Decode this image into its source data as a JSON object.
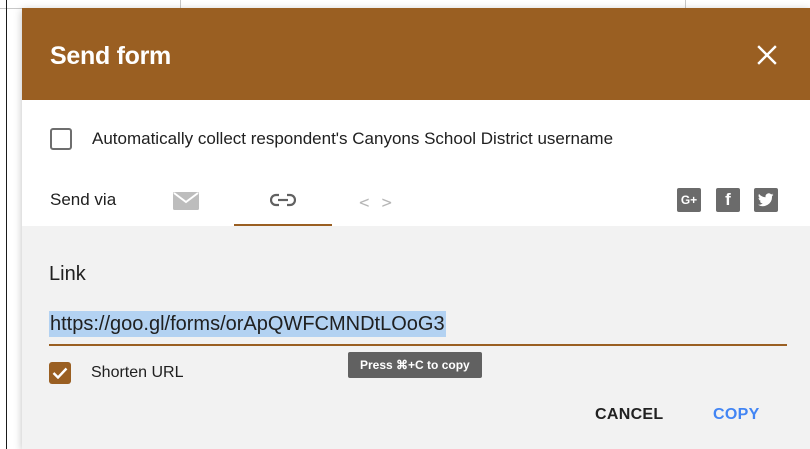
{
  "dialog": {
    "title": "Send form",
    "close_icon": "close-icon"
  },
  "collect": {
    "label": "Automatically collect respondent's Canyons School District username",
    "checked": false
  },
  "send_via": {
    "label": "Send via",
    "tabs": [
      {
        "id": "email",
        "icon": "email-icon",
        "active": false
      },
      {
        "id": "link",
        "icon": "link-icon",
        "active": true
      },
      {
        "id": "embed",
        "icon": "embed-code-icon",
        "glyph": "< >",
        "active": false
      }
    ],
    "social": [
      {
        "id": "google-plus",
        "icon": "google-plus-icon",
        "glyph": "G+"
      },
      {
        "id": "facebook",
        "icon": "facebook-icon",
        "glyph": "f"
      },
      {
        "id": "twitter",
        "icon": "twitter-icon"
      }
    ]
  },
  "link_panel": {
    "heading": "Link",
    "url": "https://goo.gl/forms/orApQWFCMNDtLOoG3",
    "shorten_label": "Shorten URL",
    "shorten_checked": true,
    "tooltip": "Press ⌘+C to copy"
  },
  "actions": {
    "cancel_label": "CANCEL",
    "copy_label": "COPY"
  },
  "colors": {
    "accent": "#9a5f22",
    "copy_blue": "#4285f4",
    "panel_bg": "#f2f2f2",
    "selection": "#b3d2f2"
  }
}
